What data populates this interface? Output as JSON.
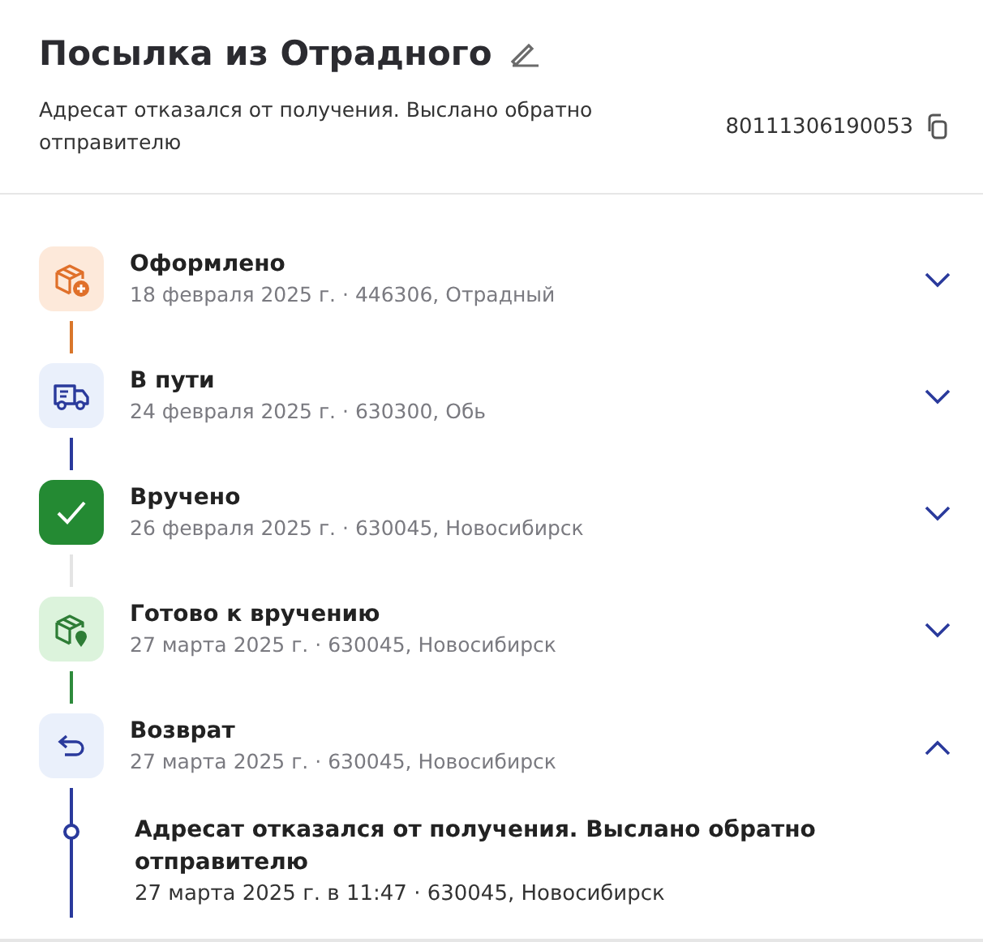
{
  "header": {
    "title": "Посылка из Отрадного",
    "status": "Адресат отказался от получения. Выслано обратно отправителю",
    "tracking_number": "80111306190053"
  },
  "steps": [
    {
      "kind": "created",
      "title": "Оформлено",
      "details": "18 февраля 2025 г. · 446306, Отрадный",
      "color": "#d9762b",
      "expanded": false
    },
    {
      "kind": "transit",
      "title": "В пути",
      "details": "24 февраля 2025 г. · 630300, Обь",
      "color": "#2a3a9c",
      "expanded": false
    },
    {
      "kind": "delivered",
      "title": "Вручено",
      "details": "26 февраля 2025 г. · 630045, Новосибирск",
      "color": "#e4e4e4",
      "expanded": false
    },
    {
      "kind": "ready",
      "title": "Готово к вручению",
      "details": "27 марта 2025 г. · 630045, Новосибирск",
      "color": "#2e8a3c",
      "expanded": false
    },
    {
      "kind": "return",
      "title": "Возврат",
      "details": "27 марта 2025 г. · 630045, Новосибирск",
      "color": "#2a3a9c",
      "expanded": true,
      "events": [
        {
          "title": "Адресат отказался от получения. Выслано обратно отправителю",
          "details": "27 марта 2025 г. в 11:47 · 630045, Новосибирск"
        }
      ]
    }
  ]
}
